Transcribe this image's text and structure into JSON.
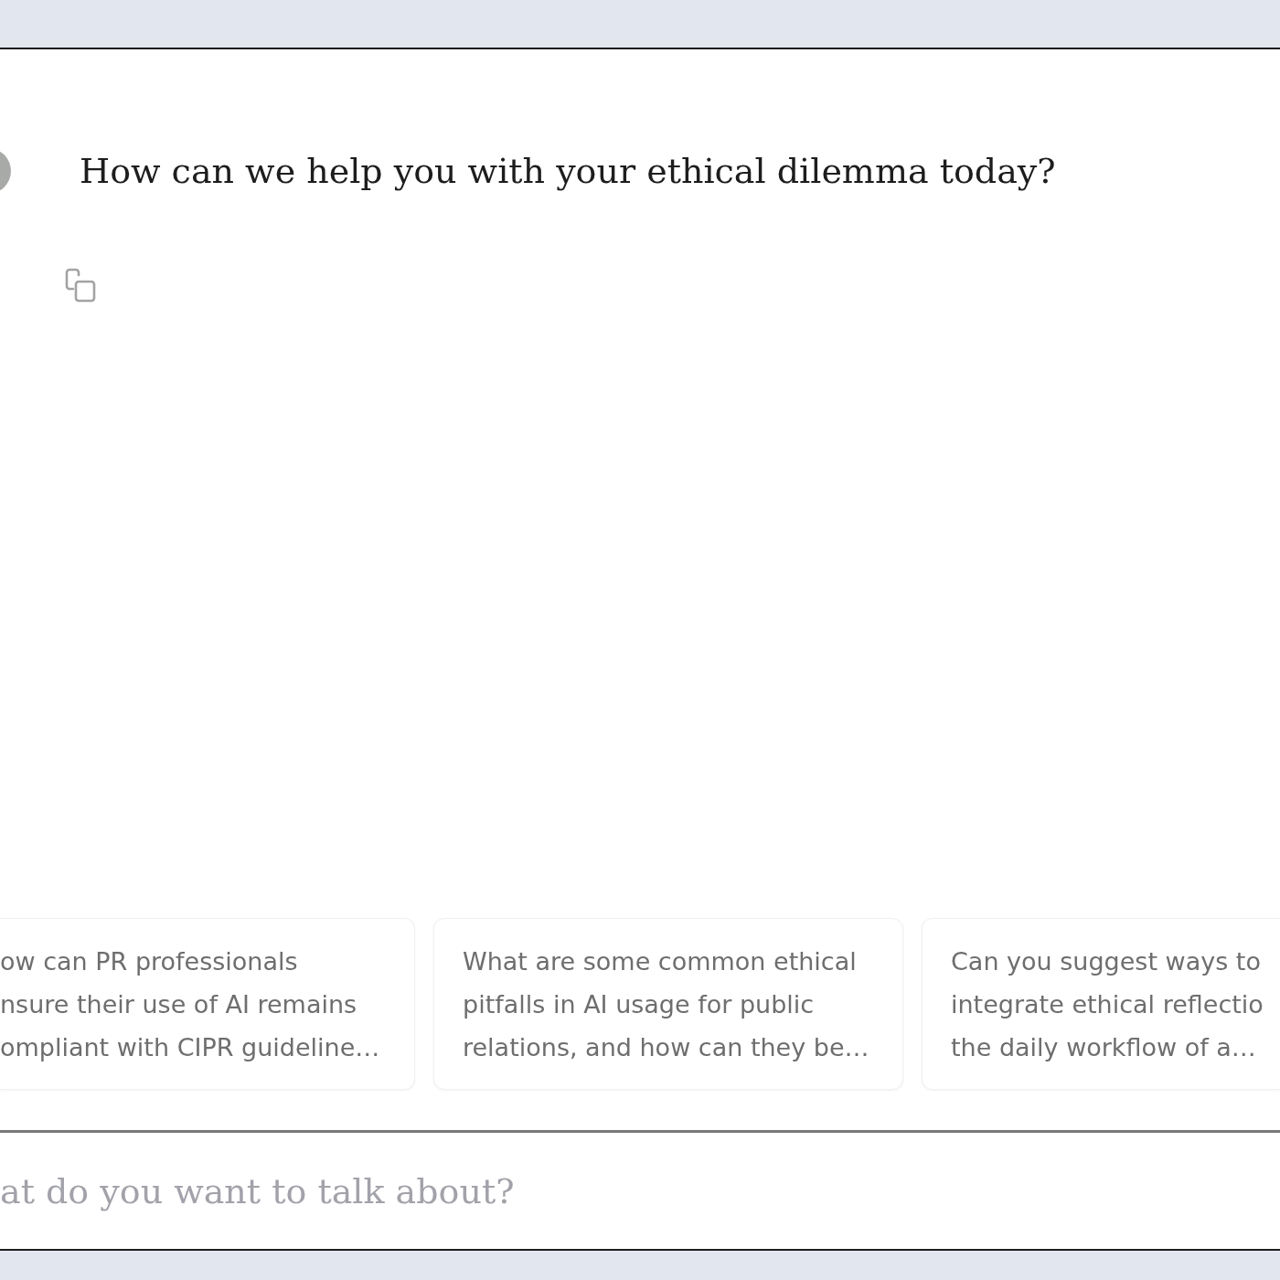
{
  "message": {
    "text": "How can we help you with your ethical dilemma today?"
  },
  "suggestions": [
    {
      "lines": [
        "ow can PR professionals",
        "nsure their use of AI remains",
        "ompliant with CIPR guideline…"
      ]
    },
    {
      "lines": [
        "What are some common ethical",
        "pitfalls in AI usage for public",
        "relations, and how can they be…"
      ]
    },
    {
      "lines": [
        "Can you suggest ways to",
        "integrate ethical reflectio",
        "the daily workflow of a…"
      ]
    }
  ],
  "composer": {
    "placeholder": "at do you want to talk about?"
  }
}
